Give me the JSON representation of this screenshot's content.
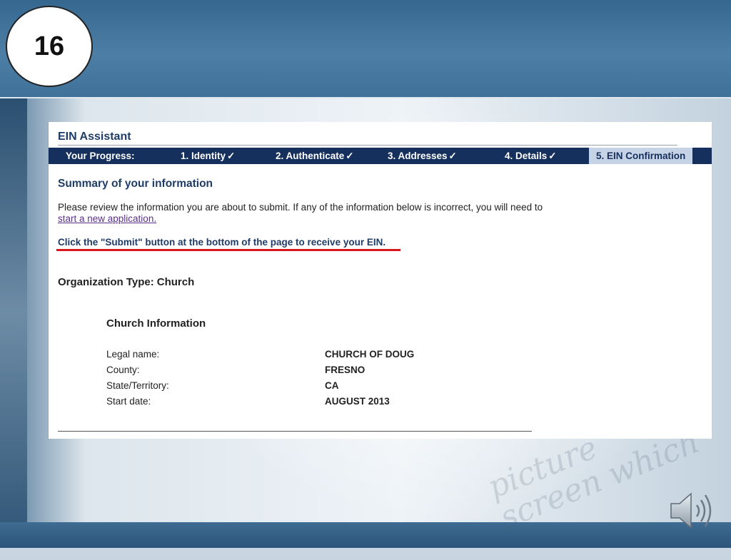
{
  "slide": {
    "number": "16",
    "background_words": "picture screen which"
  },
  "app": {
    "title": "EIN Assistant",
    "progress": {
      "label": "Your Progress:",
      "steps": [
        {
          "label": "1. Identity",
          "done": true
        },
        {
          "label": "2. Authenticate",
          "done": true
        },
        {
          "label": "3. Addresses",
          "done": true
        },
        {
          "label": "4. Details",
          "done": true
        },
        {
          "label": "5. EIN Confirmation",
          "current": true
        }
      ],
      "check": "✓"
    }
  },
  "summary": {
    "title": "Summary of your information",
    "intro_text": "Please review the information you are about to submit. If any of the information below is incorrect, you will need to",
    "intro_link": "start a new application.",
    "instruction": "Click the \"Submit\" button at the bottom of the page to receive your EIN.",
    "organization_type_label": "Organization Type:",
    "organization_type_value": "Church"
  },
  "church_info": {
    "title": "Church Information",
    "rows": [
      {
        "label": "Legal name:",
        "value": "CHURCH OF DOUG"
      },
      {
        "label": "County:",
        "value": "FRESNO"
      },
      {
        "label": "State/Territory:",
        "value": "CA"
      },
      {
        "label": "Start date:",
        "value": "AUGUST 2013"
      }
    ]
  },
  "colors": {
    "progress_bar": "#15305c",
    "current_step": "#c6d2e6",
    "heading_text": "#1f3c67",
    "highlight_underline": "#d8141c",
    "link": "#5a2f8a"
  }
}
